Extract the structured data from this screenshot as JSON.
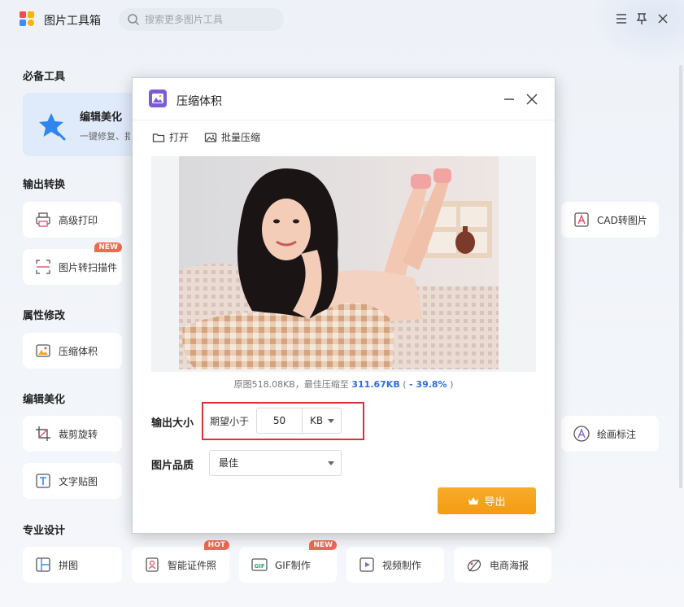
{
  "app": {
    "title": "图片工具箱",
    "search_placeholder": "搜索更多图片工具"
  },
  "sections": {
    "essential": "必备工具",
    "output": "输出转换",
    "attributes": "属性修改",
    "edit": "编辑美化",
    "design": "专业设计"
  },
  "featured": {
    "title": "编辑美化",
    "subtitle": "一键修复、抠"
  },
  "tools": {
    "print": "高级打印",
    "scan": "图片转扫描件",
    "cad": "CAD转图片",
    "compress": "压缩体积",
    "crop": "裁剪旋转",
    "text": "文字贴图",
    "draw": "绘画标注",
    "collage": "拼图",
    "idphoto": "智能证件照",
    "gif": "GIF制作",
    "video": "视频制作",
    "poster": "电商海报"
  },
  "badges": {
    "new": "NEW",
    "hot": "HOT"
  },
  "dialog": {
    "title": "压缩体积",
    "open_label": "打开",
    "batch_label": "批量压缩",
    "info_prefix": "原图518.08KB，最佳压缩至 ",
    "info_size": "311.67KB",
    "info_open": " ( ",
    "info_pct": "- 39.8%",
    "info_close": " )",
    "output_size_label": "输出大小",
    "expect_label": "期望小于",
    "size_value": "50",
    "unit_value": "KB",
    "quality_label": "图片品质",
    "quality_value": "最佳",
    "export_label": "导出"
  },
  "colors": {
    "accent": "#f5a623",
    "highlight_blue": "#2d6fdc",
    "red_frame": "#d9333a",
    "badge_red": "#f06a4d"
  }
}
